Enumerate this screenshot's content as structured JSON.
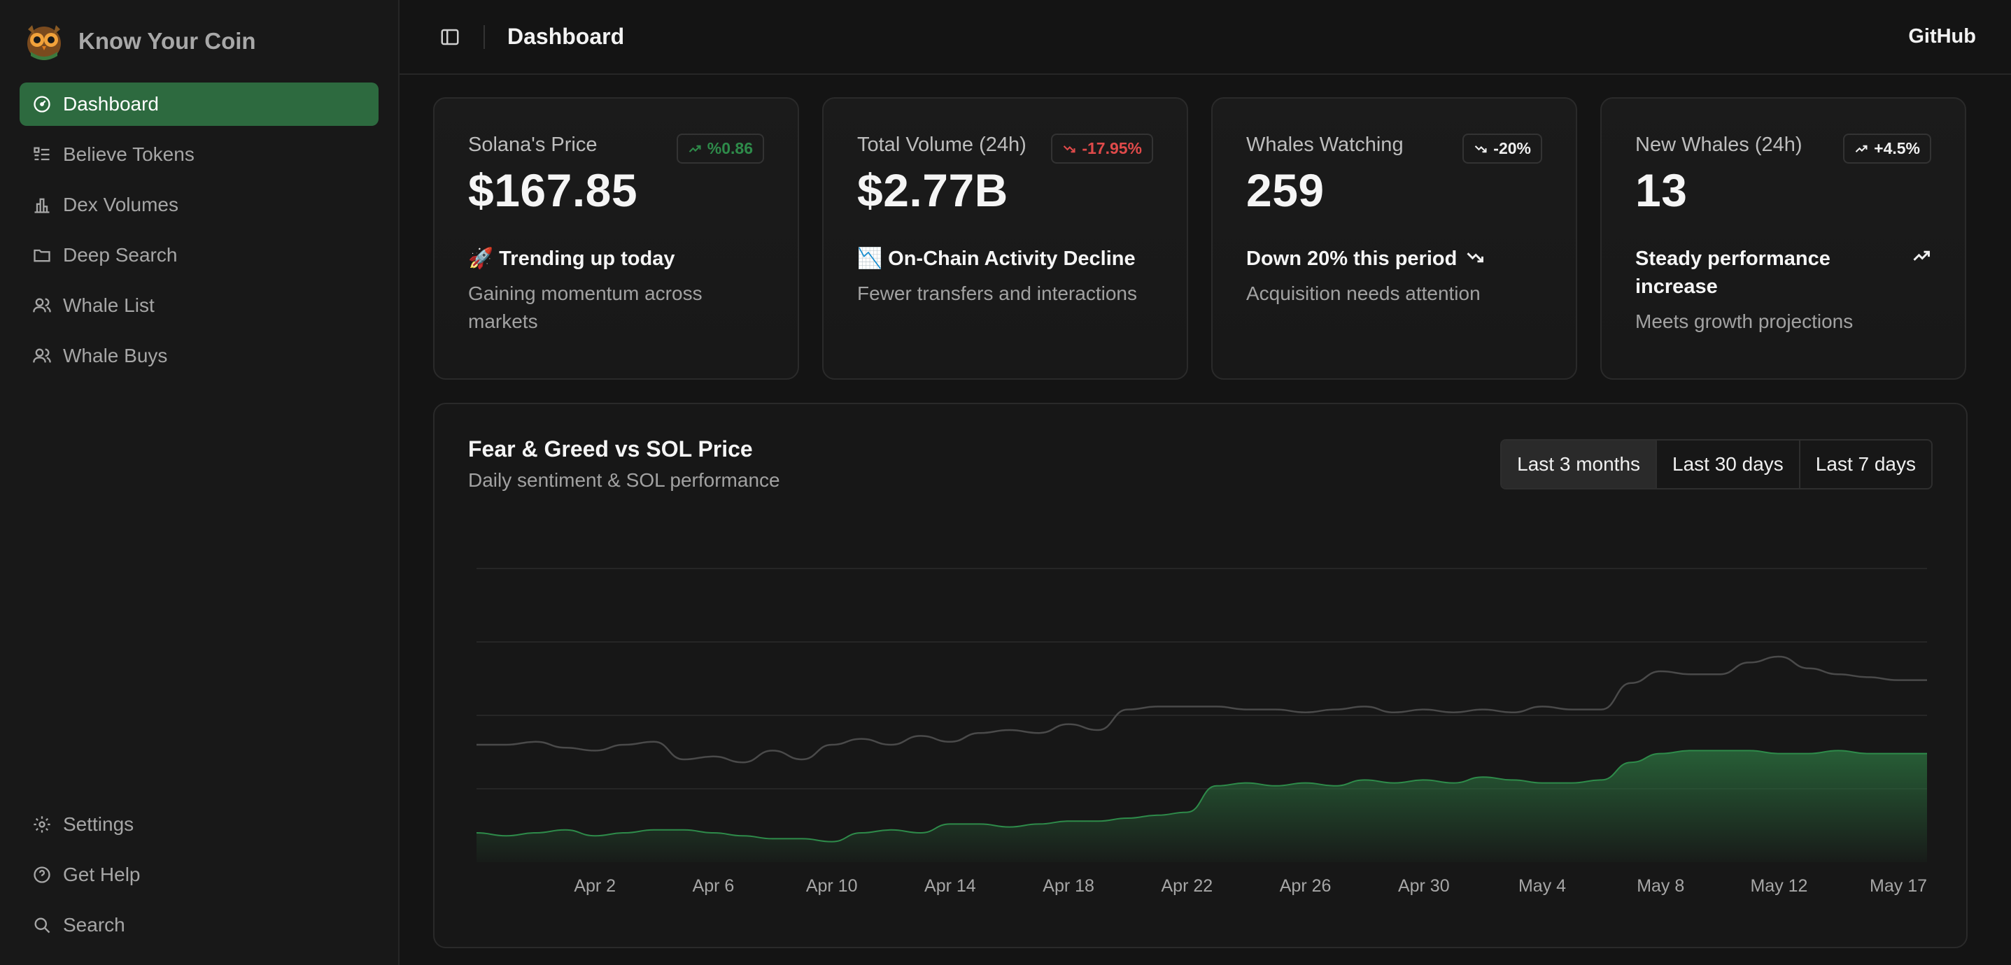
{
  "brand": {
    "name": "Know Your Coin"
  },
  "sidebar": {
    "items": [
      {
        "label": "Dashboard",
        "icon": "dashboard-icon",
        "active": true
      },
      {
        "label": "Believe Tokens",
        "icon": "list-icon"
      },
      {
        "label": "Dex Volumes",
        "icon": "bar-chart-icon"
      },
      {
        "label": "Deep Search",
        "icon": "folder-icon"
      },
      {
        "label": "Whale List",
        "icon": "users-icon"
      },
      {
        "label": "Whale Buys",
        "icon": "users-icon"
      }
    ],
    "bottom": [
      {
        "label": "Settings",
        "icon": "gear-icon"
      },
      {
        "label": "Get Help",
        "icon": "help-icon"
      },
      {
        "label": "Search",
        "icon": "search-icon"
      }
    ]
  },
  "header": {
    "title": "Dashboard",
    "github_label": "GitHub"
  },
  "cards": [
    {
      "label": "Solana's Price",
      "badge": "%0.86",
      "badge_trend": "up",
      "value": "$167.85",
      "headline": "🚀 Trending up today",
      "sub": "Gaining momentum across markets"
    },
    {
      "label": "Total Volume (24h)",
      "badge": "-17.95%",
      "badge_trend": "down",
      "value": "$2.77B",
      "headline": "📉 On-Chain Activity Decline",
      "sub": "Fewer transfers and interactions"
    },
    {
      "label": "Whales Watching",
      "badge": "-20%",
      "badge_trend": "down",
      "value": "259",
      "headline": "Down 20% this period",
      "sub": "Acquisition needs attention"
    },
    {
      "label": "New Whales (24h)",
      "badge": "+4.5%",
      "badge_trend": "up",
      "value": "13",
      "headline": "Steady performance increase",
      "sub": "Meets growth projections"
    }
  ],
  "colors": {
    "accent": "#2d6a3f",
    "positive": "#2e8b4a",
    "negative": "#e04a4a",
    "area_fill": "#2a6b3c",
    "line_gray": "#4a4a4a"
  },
  "chart": {
    "title": "Fear & Greed vs SOL Price",
    "subtitle": "Daily sentiment & SOL performance",
    "ranges": [
      "Last 3 months",
      "Last 30 days",
      "Last 7 days"
    ],
    "active_range": "Last 3 months"
  },
  "chart_data": {
    "type": "area",
    "x": [
      "Mar 29",
      "Mar 30",
      "Mar 31",
      "Apr 1",
      "Apr 2",
      "Apr 3",
      "Apr 4",
      "Apr 5",
      "Apr 6",
      "Apr 7",
      "Apr 8",
      "Apr 9",
      "Apr 10",
      "Apr 11",
      "Apr 12",
      "Apr 13",
      "Apr 14",
      "Apr 15",
      "Apr 16",
      "Apr 17",
      "Apr 18",
      "Apr 19",
      "Apr 20",
      "Apr 21",
      "Apr 22",
      "Apr 23",
      "Apr 24",
      "Apr 25",
      "Apr 26",
      "Apr 27",
      "Apr 28",
      "Apr 29",
      "Apr 30",
      "May 1",
      "May 2",
      "May 3",
      "May 4",
      "May 5",
      "May 6",
      "May 7",
      "May 8",
      "May 9",
      "May 10",
      "May 11",
      "May 12",
      "May 13",
      "May 14",
      "May 15",
      "May 16",
      "May 17"
    ],
    "x_ticks": [
      "Apr 2",
      "Apr 6",
      "Apr 10",
      "Apr 14",
      "Apr 18",
      "Apr 22",
      "Apr 26",
      "Apr 30",
      "May 4",
      "May 8",
      "May 12",
      "May 17"
    ],
    "series": [
      {
        "values": [
          40,
          40,
          41,
          39,
          38,
          40,
          41,
          35,
          36,
          34,
          38,
          35,
          40,
          42,
          40,
          43,
          41,
          44,
          45,
          44,
          47,
          45,
          52,
          53,
          53,
          53,
          52,
          52,
          51,
          52,
          53,
          51,
          52,
          51,
          52,
          51,
          53,
          52,
          52,
          61,
          65,
          64,
          64,
          68,
          70,
          66,
          64,
          63,
          62,
          62
        ],
        "style": "line"
      },
      {
        "values": [
          10,
          9,
          10,
          11,
          9,
          10,
          11,
          11,
          10,
          9,
          8,
          8,
          7,
          10,
          11,
          10,
          13,
          13,
          12,
          13,
          14,
          14,
          15,
          16,
          17,
          26,
          27,
          26,
          27,
          26,
          28,
          27,
          28,
          27,
          29,
          28,
          27,
          27,
          28,
          34,
          37,
          38,
          38,
          38,
          37,
          37,
          38,
          37,
          37,
          37
        ],
        "style": "area"
      }
    ],
    "ylim": [
      0,
      100
    ],
    "grid": true
  }
}
